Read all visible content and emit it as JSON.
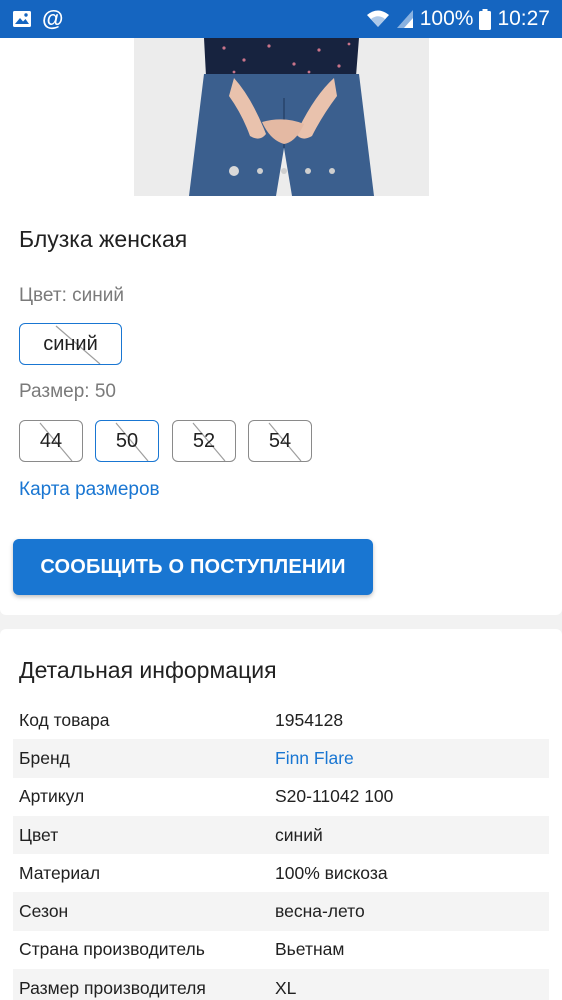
{
  "status_bar": {
    "left_icons": [
      "gallery-icon",
      "at-sign-icon"
    ],
    "right_icons": [
      "wifi-icon",
      "signal-icon",
      "battery-icon"
    ],
    "battery": "100%",
    "time": "10:27"
  },
  "product": {
    "image_pager": {
      "count": 5,
      "active": 0
    },
    "title": "Блузка женская",
    "color_label": "Цвет: синий",
    "color_options": [
      "синий"
    ],
    "size_label": "Размер: 50",
    "sizes": [
      "44",
      "50",
      "52",
      "54"
    ],
    "selected_size": "50",
    "size_chart_link": "Карта размеров",
    "notify_button": "СООБЩИТЬ О ПОСТУПЛЕНИИ"
  },
  "details": {
    "title": "Детальная информация",
    "rows": [
      {
        "key": "Код товара",
        "value": "1954128"
      },
      {
        "key": "Бренд",
        "value": "Finn Flare"
      },
      {
        "key": "Артикул",
        "value": "S20-11042 100"
      },
      {
        "key": "Цвет",
        "value": "синий"
      },
      {
        "key": "Материал",
        "value": "100% вискоза"
      },
      {
        "key": "Сезон",
        "value": "весна-лето"
      },
      {
        "key": "Страна производитель",
        "value": "Вьетнам"
      },
      {
        "key": "Размер производителя",
        "value": "XL"
      }
    ]
  },
  "colors": {
    "status_bar": "#1565c0",
    "accent": "#1976d2",
    "muted_text": "#7a7a7a"
  }
}
